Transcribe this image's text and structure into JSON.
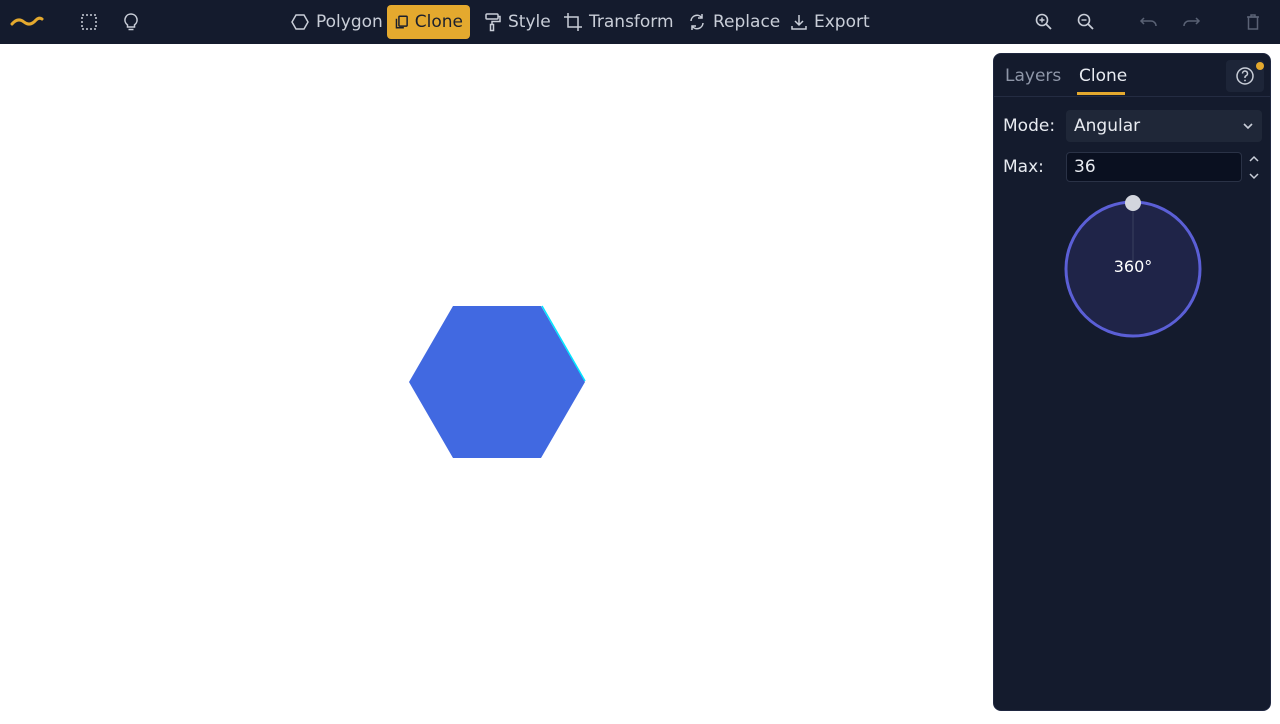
{
  "toolbar": {
    "items": [
      {
        "label": "Polygon",
        "icon": "hexagon-outline-icon"
      },
      {
        "label": "Clone",
        "icon": "clone-icon",
        "active": true
      },
      {
        "label": "Style",
        "icon": "paint-roller-icon"
      },
      {
        "label": "Transform",
        "icon": "transform-icon"
      },
      {
        "label": "Replace",
        "icon": "replace-icon"
      },
      {
        "label": "Export",
        "icon": "download-icon"
      }
    ],
    "accent_color": "#e4a92e"
  },
  "canvas": {
    "shape": "hexagon",
    "fill_color": "#4169e1",
    "edge_highlight_color": "#00e5ff"
  },
  "panel": {
    "tabs": [
      {
        "label": "Layers"
      },
      {
        "label": "Clone",
        "active": true
      }
    ],
    "mode_label": "Mode:",
    "mode_value": "Angular",
    "max_label": "Max:",
    "max_value": "36",
    "angle_text": "360°",
    "angle_fraction": 1.0
  }
}
